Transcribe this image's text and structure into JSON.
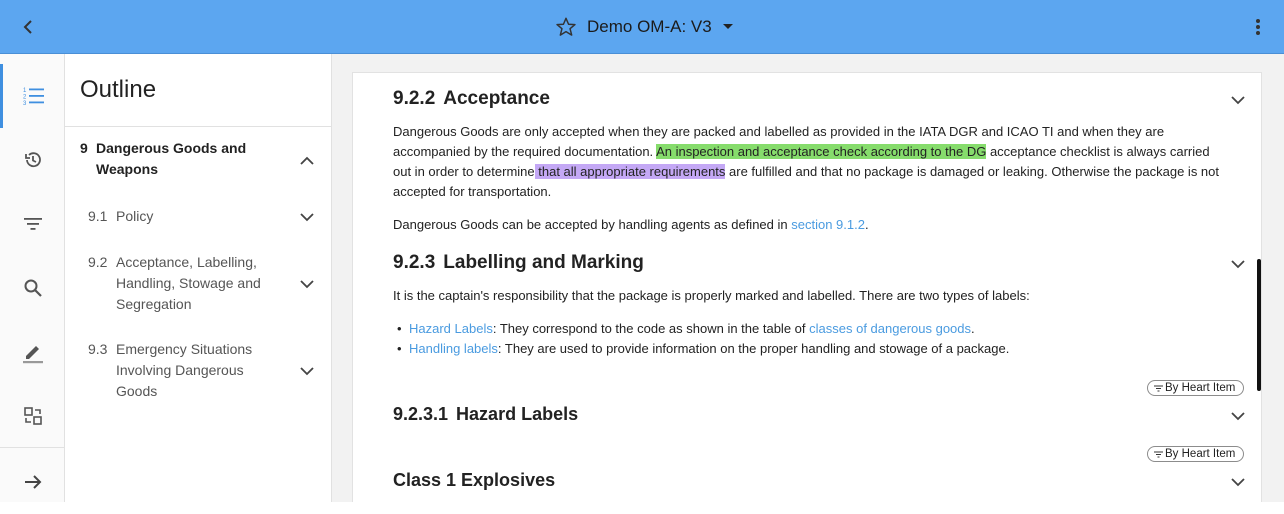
{
  "header": {
    "title": "Demo OM-A: V3",
    "back_icon": "chevron-left-icon",
    "favorite_icon": "star-outline-icon",
    "dropdown_icon": "caret-down-icon",
    "more_icon": "more-vertical-icon",
    "bg_color": "#5ca6f0"
  },
  "rail": {
    "items": [
      {
        "icon": "list-outline-icon",
        "active": true
      },
      {
        "icon": "history-icon",
        "active": false
      },
      {
        "icon": "filter-icon",
        "active": false
      },
      {
        "icon": "search-icon",
        "active": false
      },
      {
        "icon": "edit-pen-icon",
        "active": false
      },
      {
        "icon": "compare-swap-icon",
        "active": false
      },
      {
        "icon": "arrow-right-icon",
        "active": false
      }
    ]
  },
  "outline": {
    "title": "Outline",
    "chapter": {
      "number": "9",
      "label": "Dangerous Goods and Weapons",
      "line1": "Dangerous Goods and",
      "line2": "Weapons"
    },
    "items": [
      {
        "number": "9.1",
        "lines": [
          "Policy"
        ]
      },
      {
        "number": "9.2",
        "lines": [
          "Acceptance, Labelling,",
          "Handling, Stowage and",
          "Segregation"
        ]
      },
      {
        "number": "9.3",
        "lines": [
          "Emergency Situations",
          "Involving Dangerous",
          "Goods"
        ]
      }
    ]
  },
  "content": {
    "s922": {
      "number": "9.2.2",
      "title": "Acceptance",
      "p1_a": "Dangerous Goods are only accepted when they are packed and labelled as provided in the IATA DGR and ICAO TI and when they are accompanied by the required documentation. ",
      "p1_hl_green": "An inspection and acceptance check according to the DG",
      "p1_b": " acceptance checklist is always carried out in order to determine",
      "p1_hl_purple": " that all appropriate requirements",
      "p1_c": " are fulfilled and that no package is damaged or leaking. Otherwise the package is not accepted for transportation.",
      "p2_a": "Dangerous Goods can be accepted by handling agents as defined in ",
      "p2_link": "section 9.1.2",
      "p2_b": "."
    },
    "s923": {
      "number": "9.2.3",
      "title": "Labelling and Marking",
      "p1": "It is the captain's responsibility that the package is properly marked and labelled. There are two types of labels:",
      "bullets": [
        {
          "link": "Hazard Labels",
          "text": ": They correspond to the code as shown in the table of ",
          "link2": "classes of dangerous goods",
          "tail": "."
        },
        {
          "link": "Handling labels",
          "text": ": They are used to provide information on the proper handling and stowage of a package."
        }
      ]
    },
    "pill_label": "By Heart Item",
    "s9231": {
      "number": "9.2.3.1",
      "title": "Hazard Labels"
    },
    "class1": {
      "title": "Class 1 Explosives"
    }
  }
}
